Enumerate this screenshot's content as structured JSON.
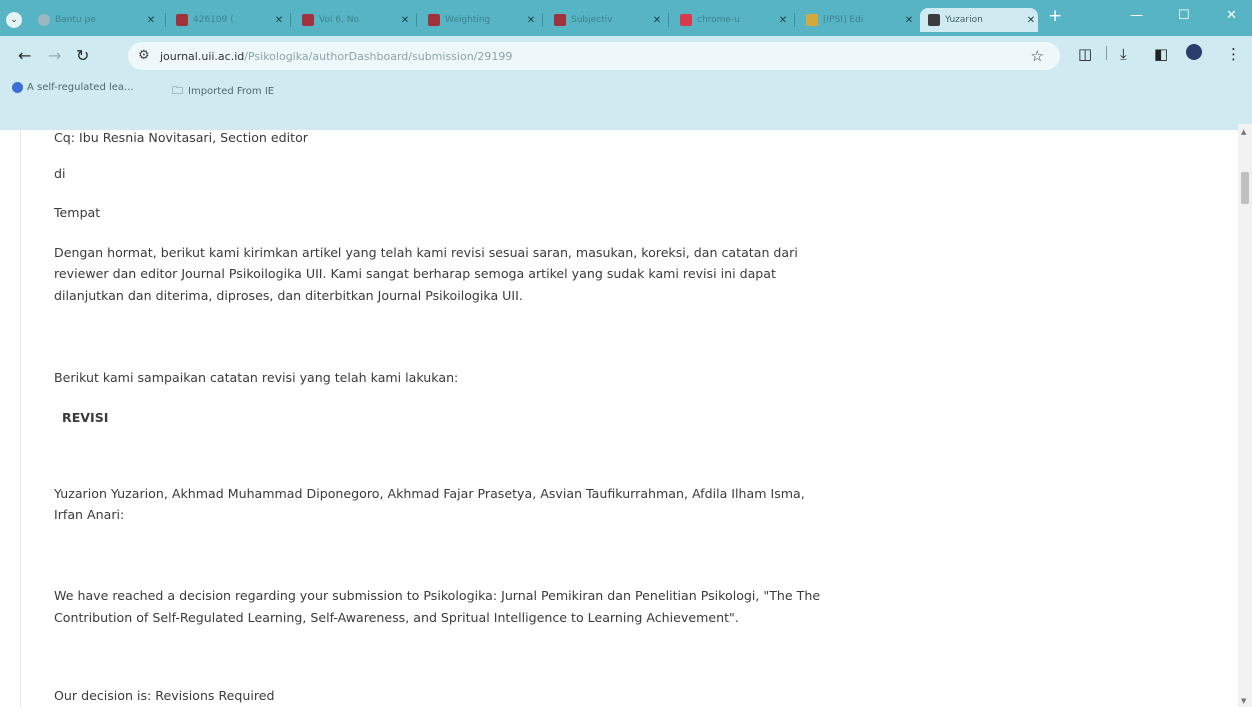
{
  "browser": {
    "tabs": [
      {
        "label": "Bantu pe",
        "color": "#9ab8be"
      },
      {
        "label": "426109 (",
        "color": "#a0323c"
      },
      {
        "label": "Vol 6, No",
        "color": "#a0323c"
      },
      {
        "label": "Weighting",
        "color": "#a0323c"
      },
      {
        "label": "Subjectiv",
        "color": "#a0323c"
      },
      {
        "label": "chrome-u",
        "color": "#d73a4a"
      },
      {
        "label": "[IPSI] Edi",
        "color": "#d4a83a"
      },
      {
        "label": "Yuzarion",
        "color": "#3d3d3d"
      }
    ],
    "new_tab": "+",
    "url_host": "journal.uii.ac.id",
    "url_path": "/Psikologika/authorDashboard/submission/29199",
    "bookmarks": [
      {
        "label": "A self-regulated lea..."
      },
      {
        "label": "Imported From IE"
      }
    ]
  },
  "content": {
    "cq_line": "Cq: Ibu Resnia Novitasari, Section editor",
    "di": "di",
    "tempat": "Tempat",
    "para1_l1": "Dengan hormat, berikut kami kirimkan artikel yang telah kami revisi sesuai saran, masukan, koreksi, dan catatan dari",
    "para1_l2": "reviewer dan editor Journal Psikoilogika UII. Kami sangat berharap semoga artikel yang sudak kami revisi ini dapat",
    "para1_l3": "dilanjutkan dan diterima, diproses, dan diterbitkan Journal Psikoilogika UII.",
    "berikut": "Berikut kami sampaikan catatan revisi yang telah kami lakukan:",
    "revisi": "REVISI",
    "authors_l1": "Yuzarion Yuzarion, Akhmad Muhammad Diponegoro, Akhmad Fajar Prasetya, Asvian Taufikurrahman, Afdila Ilham Isma,",
    "authors_l2": "Irfan Anari:",
    "decision_l1": "We have reached a decision regarding your submission to Psikologika: Jurnal Pemikiran dan Penelitian Psikologi, \"The The",
    "decision_l2": "Contribution of Self-Regulated Learning, Self-Awareness, and Spritual Intelligence to Learning Achievement\".",
    "our_decision": "Our decision is: Revisions Required"
  }
}
